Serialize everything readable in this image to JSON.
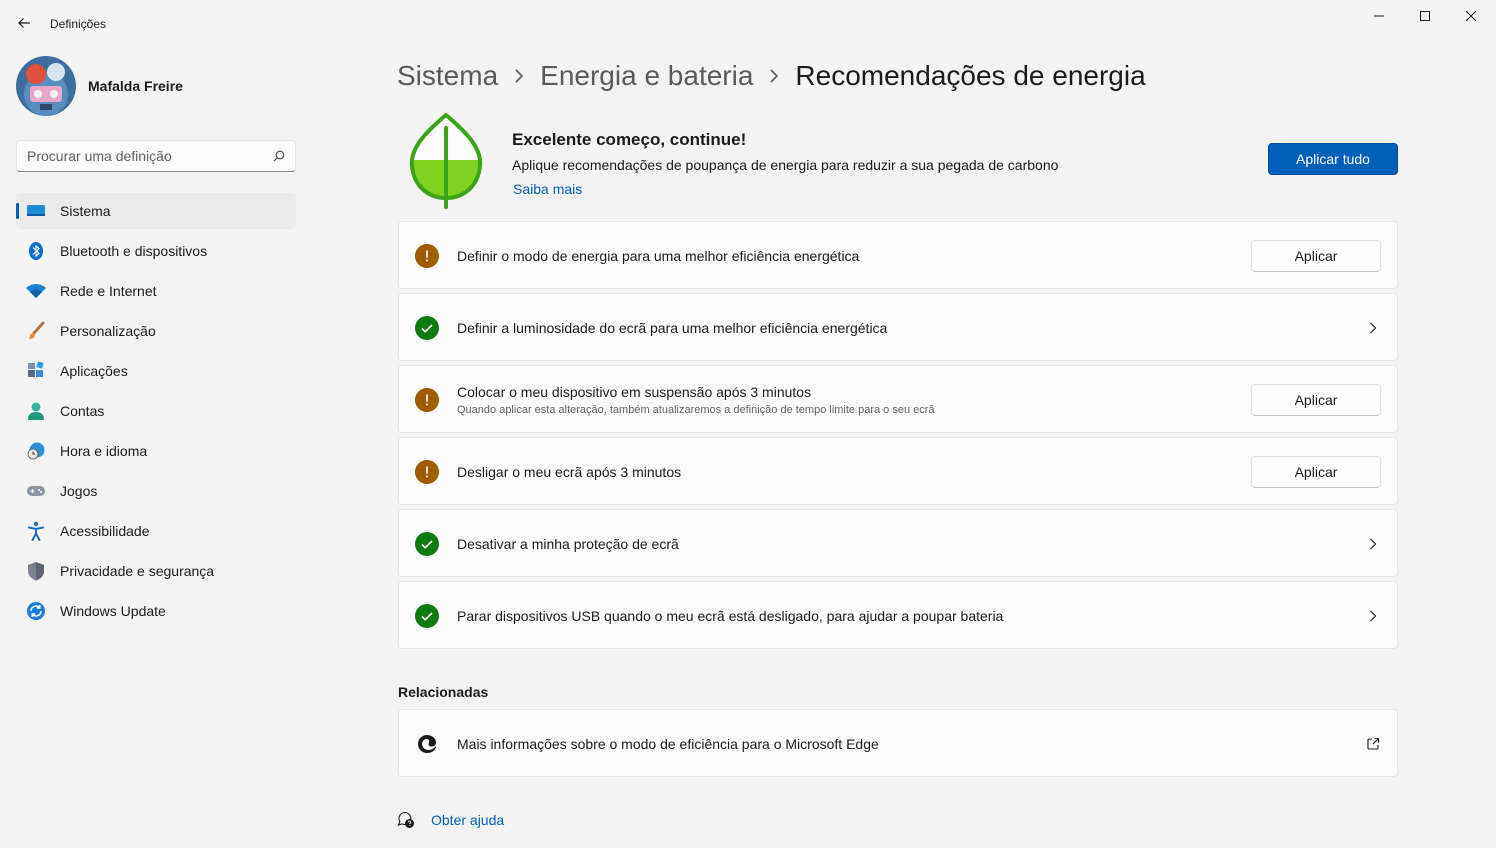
{
  "app": {
    "title": "Definições"
  },
  "profile": {
    "name": "Mafalda Freire"
  },
  "search": {
    "placeholder": "Procurar uma definição"
  },
  "sidebar": {
    "items": [
      {
        "label": "Sistema",
        "icon": "monitor-icon",
        "active": true
      },
      {
        "label": "Bluetooth e dispositivos",
        "icon": "bluetooth-icon"
      },
      {
        "label": "Rede e Internet",
        "icon": "wifi-icon"
      },
      {
        "label": "Personalização",
        "icon": "paintbrush-icon"
      },
      {
        "label": "Aplicações",
        "icon": "apps-icon"
      },
      {
        "label": "Contas",
        "icon": "person-icon"
      },
      {
        "label": "Hora e idioma",
        "icon": "globe-clock-icon"
      },
      {
        "label": "Jogos",
        "icon": "gamepad-icon"
      },
      {
        "label": "Acessibilidade",
        "icon": "accessibility-icon"
      },
      {
        "label": "Privacidade e segurança",
        "icon": "shield-icon"
      },
      {
        "label": "Windows Update",
        "icon": "update-icon"
      }
    ]
  },
  "breadcrumb": {
    "parts": [
      "Sistema",
      "Energia e bateria"
    ],
    "current": "Recomendações de energia"
  },
  "hero": {
    "title": "Excelente começo, continue!",
    "description": "Aplique recomendações de poupança de energia para reduzir a sua pegada de carbono",
    "link": "Saiba mais",
    "apply_all": "Aplicar tudo"
  },
  "recommendations": [
    {
      "title": "Definir o modo de energia para uma melhor eficiência energética",
      "status": "warning",
      "action": "Aplicar"
    },
    {
      "title": "Definir a luminosidade do ecrã para uma melhor eficiência energética",
      "status": "ok"
    },
    {
      "title": "Colocar o meu dispositivo em suspensão após 3 minutos",
      "subtitle": "Quando aplicar esta alteração, também atualizaremos a definição de tempo limite para o seu ecrã",
      "status": "warning",
      "action": "Aplicar"
    },
    {
      "title": "Desligar o meu ecrã após 3 minutos",
      "status": "warning",
      "action": "Aplicar"
    },
    {
      "title": "Desativar a minha proteção de ecrã",
      "status": "ok"
    },
    {
      "title": "Parar dispositivos USB quando o meu ecrã está desligado, para ajudar a poupar bateria",
      "status": "ok"
    }
  ],
  "related": {
    "heading": "Relacionadas",
    "items": [
      {
        "title": "Mais informações sobre o modo de eficiência para o Microsoft Edge",
        "icon": "edge-icon"
      }
    ]
  },
  "help": {
    "label": "Obter ajuda"
  },
  "colors": {
    "accent": "#005fb8",
    "warning": "#9d5d00",
    "success": "#0f7b0f",
    "leaf": "#6ccb1f"
  }
}
